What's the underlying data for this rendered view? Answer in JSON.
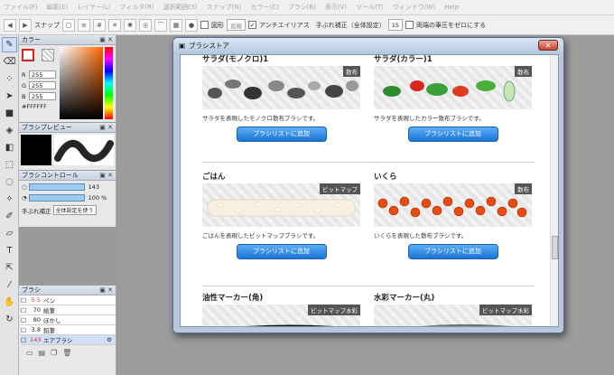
{
  "menu": [
    "ファイル(F)",
    "編集(E)",
    "レイヤー(L)",
    "フィルタ(R)",
    "選択範囲(S)",
    "スナップ(N)",
    "カラー(C)",
    "ブラシ(B)",
    "表示(V)",
    "ツール(T)",
    "ウィンドウ(W)",
    "Help"
  ],
  "toolbar": {
    "snap_label": "スナップ",
    "shape_label": "図形",
    "shape_value": "直線",
    "antialias_label": "アンチエイリアス",
    "stabilizer_label": "手ぶれ補正（全体設定）",
    "stabilizer_value": "15",
    "pressure_label": "両端の筆圧をゼロにする"
  },
  "color_panel": {
    "title": "カラー",
    "r_label": "R",
    "r_value": "255",
    "g_label": "G",
    "g_value": "255",
    "b_label": "B",
    "b_value": "255",
    "hex": "#FFFFFF"
  },
  "brush_preview": {
    "title": "ブラシプレビュー"
  },
  "brush_control": {
    "title": "ブラシコントロール",
    "size": "143",
    "opacity": "100 %",
    "stab_label": "手ぶれ補正",
    "stab_value": "全体設定を使う"
  },
  "brush_panel": {
    "title": "ブラシ",
    "items": [
      {
        "num": "5.5",
        "name": "ペン"
      },
      {
        "num": "70",
        "name": "絵筆"
      },
      {
        "num": "80",
        "name": "ぼかし"
      },
      {
        "num": "3.8",
        "name": "鉛筆"
      },
      {
        "num": "143",
        "name": "エアブラシ"
      }
    ]
  },
  "store": {
    "title": "ブラシストア",
    "button_label": "ブラシリストに追加",
    "items": [
      {
        "title": "サラダ(モノクロ)1",
        "tag": "散布",
        "desc": "サラダを表現したモノクロ散布ブラシです。"
      },
      {
        "title": "サラダ(カラー)1",
        "tag": "散布",
        "desc": "サラダを表現したカラー散布ブラシです。"
      },
      {
        "title": "ごはん",
        "tag": "ビットマップ",
        "desc": "ごはんを表現したビットマップブラシです。"
      },
      {
        "title": "いくら",
        "tag": "散布",
        "desc": "いくらを表現した散布ブラシです。"
      },
      {
        "title": "油性マーカー(角)",
        "tag": "ビットマップ水彩"
      },
      {
        "title": "水彩マーカー(丸)",
        "tag": "ビットマップ水彩"
      }
    ]
  }
}
